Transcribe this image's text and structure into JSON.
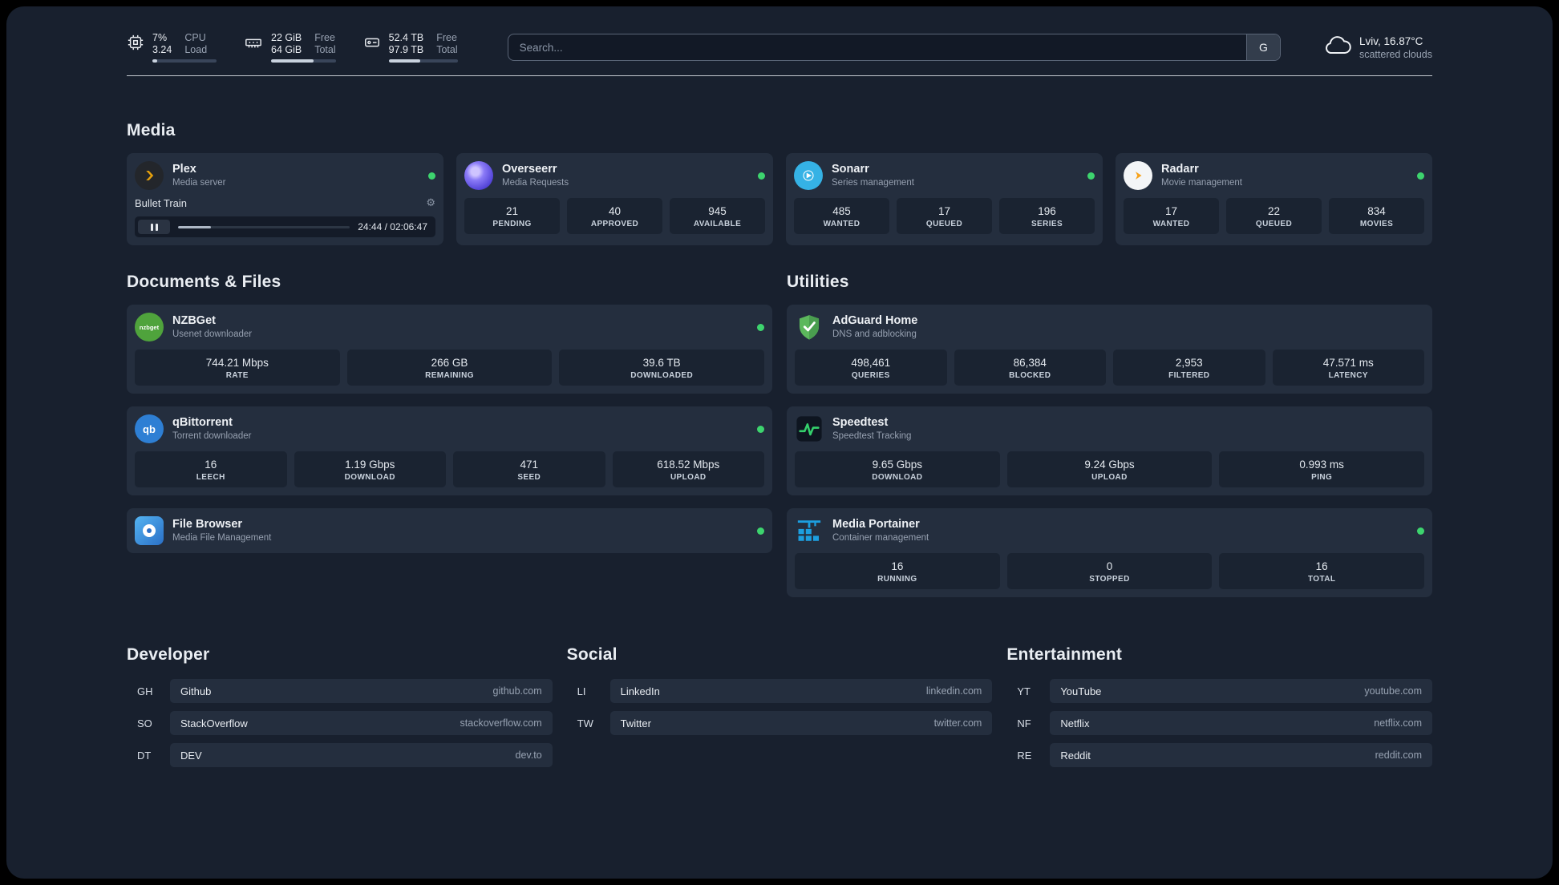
{
  "colors": {
    "page_bg": "#18202e",
    "card_bg": "#242e3e",
    "tile_bg": "#1a2331",
    "status_green": "#3dd46e",
    "plex_amber": "#e5a00d",
    "sonarr_blue": "#35b2e5",
    "radarr_orange": "#f7a21b",
    "adguard_green": "#5cb85c",
    "portainer_blue": "#1c9fe0"
  },
  "icons": {
    "gear": "⚙",
    "search_button": "G",
    "nzbget_text": "nzbget",
    "qb_text": "qb"
  },
  "topbar": {
    "cpu": {
      "value1": "7%",
      "value2": "3.24",
      "label1": "CPU",
      "label2": "Load",
      "percent": 7
    },
    "memory": {
      "value1": "22 GiB",
      "value2": "64 GiB",
      "label1": "Free",
      "label2": "Total",
      "percent": 66
    },
    "disk": {
      "value1": "52.4 TB",
      "value2": "97.9 TB",
      "label1": "Free",
      "label2": "Total",
      "percent": 46
    },
    "search": {
      "placeholder": "Search...",
      "button": "G"
    },
    "weather": {
      "location": "Lviv, 16.87°C",
      "condition": "scattered clouds"
    }
  },
  "sections": {
    "media": "Media",
    "documents": "Documents & Files",
    "utilities": "Utilities",
    "developer": "Developer",
    "social": "Social",
    "entertainment": "Entertainment"
  },
  "services": {
    "plex": {
      "name": "Plex",
      "subtitle": "Media server",
      "now_playing": "Bullet Train",
      "time": "24:44 / 02:06:47",
      "progress_percent": 19
    },
    "overseerr": {
      "name": "Overseerr",
      "subtitle": "Media Requests",
      "stats": [
        {
          "value": "21",
          "label": "PENDING"
        },
        {
          "value": "40",
          "label": "APPROVED"
        },
        {
          "value": "945",
          "label": "AVAILABLE"
        }
      ]
    },
    "sonarr": {
      "name": "Sonarr",
      "subtitle": "Series management",
      "stats": [
        {
          "value": "485",
          "label": "WANTED"
        },
        {
          "value": "17",
          "label": "QUEUED"
        },
        {
          "value": "196",
          "label": "SERIES"
        }
      ]
    },
    "radarr": {
      "name": "Radarr",
      "subtitle": "Movie management",
      "stats": [
        {
          "value": "17",
          "label": "WANTED"
        },
        {
          "value": "22",
          "label": "QUEUED"
        },
        {
          "value": "834",
          "label": "MOVIES"
        }
      ]
    },
    "nzbget": {
      "name": "NZBGet",
      "subtitle": "Usenet downloader",
      "stats": [
        {
          "value": "744.21 Mbps",
          "label": "RATE"
        },
        {
          "value": "266 GB",
          "label": "REMAINING"
        },
        {
          "value": "39.6 TB",
          "label": "DOWNLOADED"
        }
      ]
    },
    "qbittorrent": {
      "name": "qBittorrent",
      "subtitle": "Torrent downloader",
      "stats": [
        {
          "value": "16",
          "label": "LEECH"
        },
        {
          "value": "1.19 Gbps",
          "label": "DOWNLOAD"
        },
        {
          "value": "471",
          "label": "SEED"
        },
        {
          "value": "618.52 Mbps",
          "label": "UPLOAD"
        }
      ]
    },
    "filebrowser": {
      "name": "File Browser",
      "subtitle": "Media File Management"
    },
    "adguard": {
      "name": "AdGuard Home",
      "subtitle": "DNS and adblocking",
      "stats": [
        {
          "value": "498,461",
          "label": "QUERIES"
        },
        {
          "value": "86,384",
          "label": "BLOCKED"
        },
        {
          "value": "2,953",
          "label": "FILTERED"
        },
        {
          "value": "47.571 ms",
          "label": "LATENCY"
        }
      ]
    },
    "speedtest": {
      "name": "Speedtest",
      "subtitle": "Speedtest Tracking",
      "stats": [
        {
          "value": "9.65 Gbps",
          "label": "DOWNLOAD"
        },
        {
          "value": "9.24 Gbps",
          "label": "UPLOAD"
        },
        {
          "value": "0.993 ms",
          "label": "PING"
        }
      ]
    },
    "portainer": {
      "name": "Media Portainer",
      "subtitle": "Container management",
      "stats": [
        {
          "value": "16",
          "label": "RUNNING"
        },
        {
          "value": "0",
          "label": "STOPPED"
        },
        {
          "value": "16",
          "label": "TOTAL"
        }
      ]
    }
  },
  "bookmarks": {
    "developer": [
      {
        "abbr": "GH",
        "name": "Github",
        "url": "github.com"
      },
      {
        "abbr": "SO",
        "name": "StackOverflow",
        "url": "stackoverflow.com"
      },
      {
        "abbr": "DT",
        "name": "DEV",
        "url": "dev.to"
      }
    ],
    "social": [
      {
        "abbr": "LI",
        "name": "LinkedIn",
        "url": "linkedin.com"
      },
      {
        "abbr": "TW",
        "name": "Twitter",
        "url": "twitter.com"
      }
    ],
    "entertainment": [
      {
        "abbr": "YT",
        "name": "YouTube",
        "url": "youtube.com"
      },
      {
        "abbr": "NF",
        "name": "Netflix",
        "url": "netflix.com"
      },
      {
        "abbr": "RE",
        "name": "Reddit",
        "url": "reddit.com"
      }
    ]
  }
}
